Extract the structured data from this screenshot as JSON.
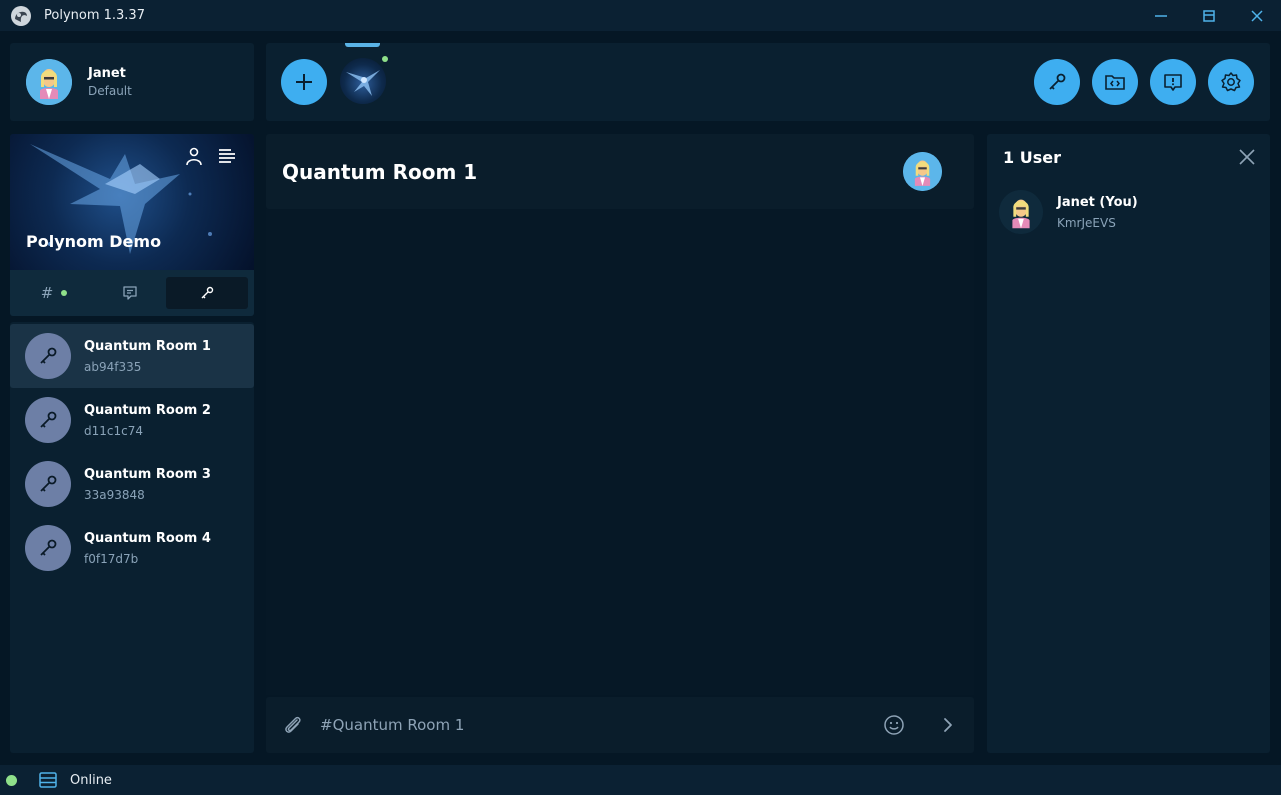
{
  "window": {
    "title": "Polynom 1.3.37"
  },
  "user": {
    "name": "Janet",
    "status": "Default"
  },
  "server": {
    "name": "Polynom Demo"
  },
  "tabs": [
    {
      "icon": "hash-icon",
      "has_unread": true
    },
    {
      "icon": "chat-icon",
      "has_unread": false
    },
    {
      "icon": "key-icon",
      "active": true
    }
  ],
  "rooms": [
    {
      "name": "Quantum Room 1",
      "id": "ab94f335",
      "selected": true
    },
    {
      "name": "Quantum Room 2",
      "id": "d11c1c74"
    },
    {
      "name": "Quantum Room 3",
      "id": "33a93848"
    },
    {
      "name": "Quantum Room 4",
      "id": "f0f17d7b"
    }
  ],
  "chat": {
    "title": "Quantum Room 1",
    "input_placeholder": "#Quantum Room 1"
  },
  "users_panel": {
    "title": "1 User",
    "members": [
      {
        "name": "Janet (You)",
        "id": "KmrJeEVS"
      }
    ]
  },
  "toolbar": {
    "buttons": [
      "add-icon",
      "key-icon",
      "folder-code-icon",
      "info-icon",
      "settings-icon"
    ]
  },
  "statusbar": {
    "status": "Online"
  },
  "colors": {
    "accent": "#3eaef0",
    "online": "#8fe08a",
    "background": "#051725"
  }
}
